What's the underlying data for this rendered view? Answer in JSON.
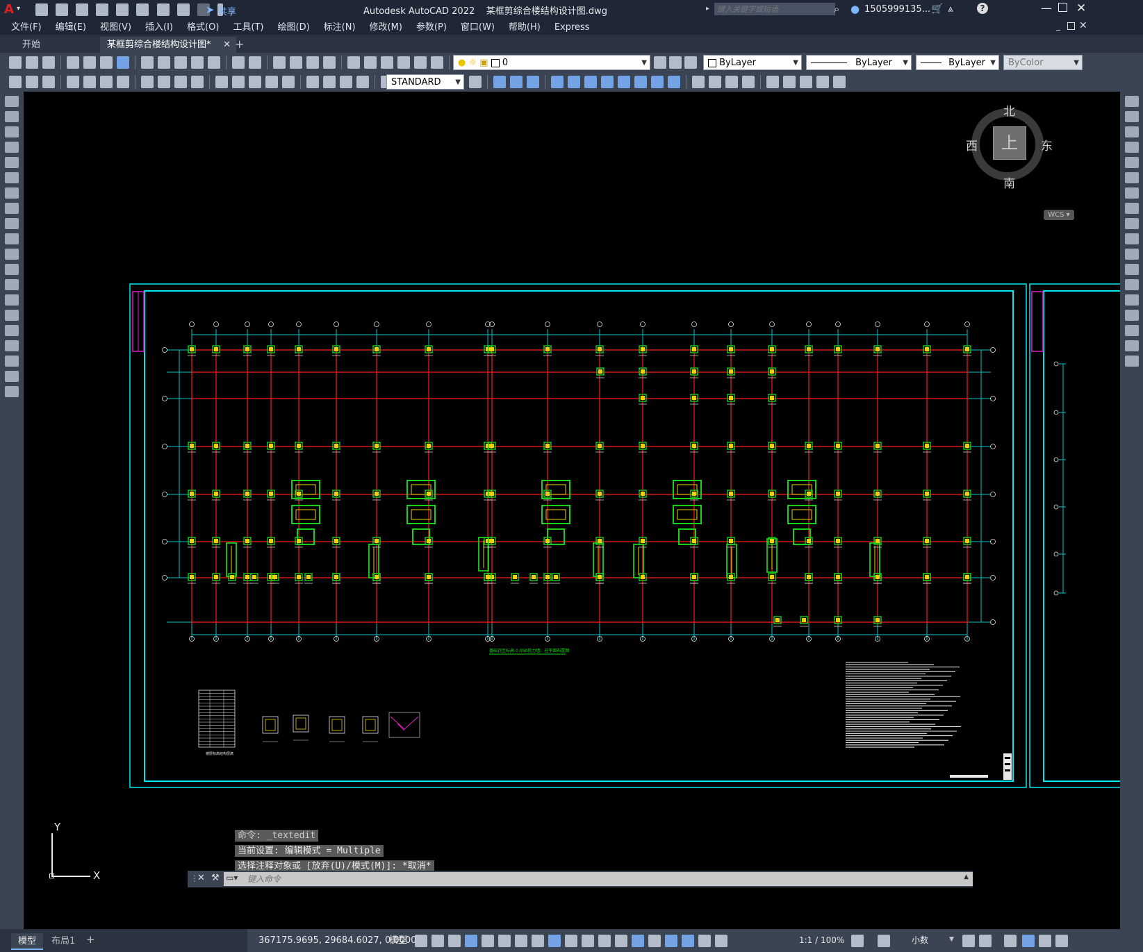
{
  "app": {
    "logo_letter": "A",
    "title": "Autodesk AutoCAD 2022    某框剪综合楼结构设计图.dwg",
    "share_label": "共享",
    "search_placeholder": "键入关键字或短语",
    "user": "1505999135...",
    "window_controls": [
      "minimize-icon",
      "maximize-icon",
      "close-icon"
    ]
  },
  "menu": [
    "文件(F)",
    "编辑(E)",
    "视图(V)",
    "插入(I)",
    "格式(O)",
    "工具(T)",
    "绘图(D)",
    "标注(N)",
    "修改(M)",
    "参数(P)",
    "窗口(W)",
    "帮助(H)",
    "Express"
  ],
  "tabs": [
    {
      "label": "开始",
      "active": false
    },
    {
      "label": "某框剪综合楼结构设计图*",
      "active": true
    }
  ],
  "add_tab_label": "+",
  "toolbar": {
    "layer_value": "0",
    "color_value": "ByLayer",
    "linetype_value": "ByLayer",
    "lineweight_value": "ByLayer",
    "plotstyle_value": "ByColor",
    "text_style_value": "STANDARD"
  },
  "viewcube": {
    "north": "北",
    "south": "南",
    "east": "东",
    "west": "西",
    "face": "上",
    "ucs_label": "WCS"
  },
  "ucs_icon": {
    "x_label": "X",
    "y_label": "Y"
  },
  "drawing": {
    "plan_title": "基础顶至标高-0.050剪力墙、柱平面布置图",
    "table_title": "楼层标高结构层高"
  },
  "command_history": [
    "命令: _textedit",
    "当前设置: 编辑模式 = Multiple",
    "选择注释对象或 [放弃(U)/模式(M)]: *取消*"
  ],
  "command_placeholder": "键入命令",
  "layout_tabs": [
    "模型",
    "布局1"
  ],
  "status": {
    "coordinates": "367175.9695, 29684.6027, 0.0000",
    "model_label": "模型",
    "scale": "1:1 / 100%",
    "units": "小数"
  },
  "colors": {
    "title_bg": "#1f2737",
    "toolbar_bg": "#3b4453",
    "canvas_bg": "#000000",
    "frame": "#00e5ee",
    "axis_red": "#ff1a1a",
    "column_green": "#19d119",
    "column_yellow": "#e8d400",
    "dim_cyan": "#00c8c8",
    "magenta": "#e020c0",
    "cmd_bg": "#5a5a5a"
  }
}
